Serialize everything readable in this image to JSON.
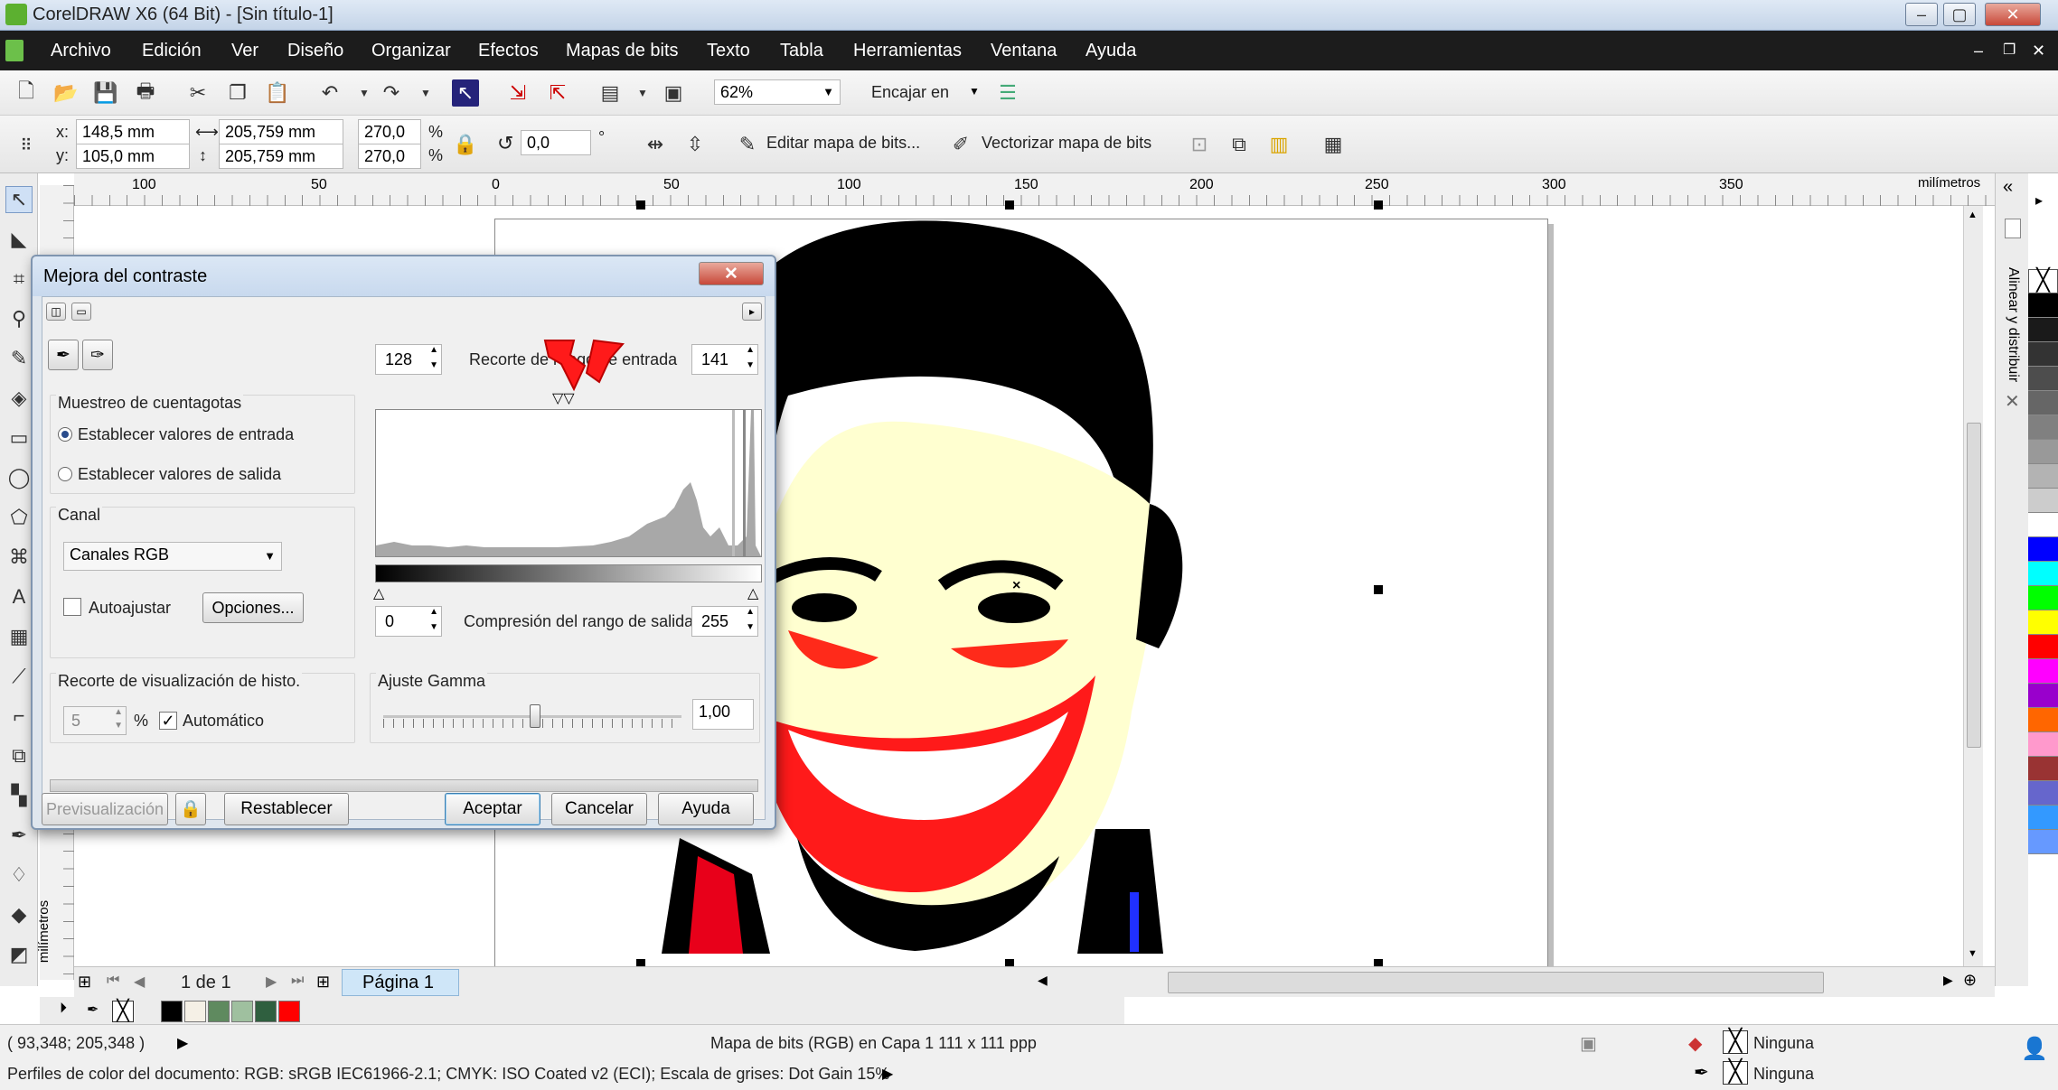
{
  "window": {
    "title": "CorelDRAW X6 (64 Bit) - [Sin título-1]"
  },
  "menu": {
    "items": [
      "Archivo",
      "Edición",
      "Ver",
      "Diseño",
      "Organizar",
      "Efectos",
      "Mapas de bits",
      "Texto",
      "Tabla",
      "Herramientas",
      "Ventana",
      "Ayuda"
    ]
  },
  "toolbar": {
    "zoom": "62%",
    "snap_label": "Encajar en"
  },
  "propbar": {
    "x_label": "x:",
    "x": "148,5 mm",
    "y_label": "y:",
    "y": "105,0 mm",
    "width": "205,759 mm",
    "height": "205,759 mm",
    "scale_x": "270,0",
    "scale_y": "270,0",
    "percent": "%",
    "rotation": "0,0",
    "degree": "°",
    "edit_bitmap": "Editar mapa de bits...",
    "trace_bitmap": "Vectorizar mapa de bits"
  },
  "ruler": {
    "labels": [
      "100",
      "50",
      "0",
      "50",
      "100",
      "150",
      "200",
      "250",
      "300",
      "350"
    ],
    "unit": "milímetros",
    "vertical_unit": "milímetros"
  },
  "dialog": {
    "title": "Mejora del contraste",
    "sampling_group": "Muestreo de cuentagotas",
    "radio_input": "Establecer valores de entrada",
    "radio_output": "Establecer valores de salida",
    "channel_group": "Canal",
    "channel_value": "Canales RGB",
    "auto_adjust": "Autoajustar",
    "options_button": "Opciones...",
    "histo_clip_label": "Recorte de visualización de histo.",
    "histo_clip_value": "5",
    "percent": "%",
    "automatic": "Automático",
    "input_low": "128",
    "input_label": "Recorte de rango de entrada",
    "input_high": "141",
    "output_low": "0",
    "output_label": "Compresión del rango de salida",
    "output_high": "255",
    "gamma_label": "Ajuste Gamma",
    "gamma_value": "1,00",
    "preview_button": "Previsualización",
    "reset_button": "Restablecer",
    "ok_button": "Aceptar",
    "cancel_button": "Cancelar",
    "help_button": "Ayuda"
  },
  "pager": {
    "page_count": "1 de 1",
    "page_tab": "Página 1"
  },
  "docker": {
    "label": "Alinear y distribuir"
  },
  "status": {
    "coords": "( 93,348; 205,348 )",
    "object_info": "Mapa de bits (RGB) en Capa 1 111 x 111 ppp",
    "profiles": "Perfiles de color del documento: RGB: sRGB IEC61966-2.1; CMYK: ISO Coated v2 (ECI); Escala de grises: Dot Gain 15%",
    "fill": "Ninguna",
    "outline": "Ninguna"
  },
  "colors": {
    "palette": [
      "#000000",
      "#1a1a1a",
      "#333333",
      "#4d4d4d",
      "#666666",
      "#808080",
      "#999999",
      "#b3b3b3",
      "#cccccc",
      "#ffffff",
      "#0000ff",
      "#00ffff",
      "#00ff00",
      "#ffff00",
      "#ff0000",
      "#ff00ff",
      "#9900cc",
      "#ff6600",
      "#ff99cc",
      "#993333",
      "#6666cc",
      "#3399ff",
      "#6699ff"
    ],
    "strip": [
      "#000000",
      "#f5f0e6",
      "#5f8a5f",
      "#9fc09f",
      "#2f5f3f",
      "#ff0000"
    ]
  }
}
